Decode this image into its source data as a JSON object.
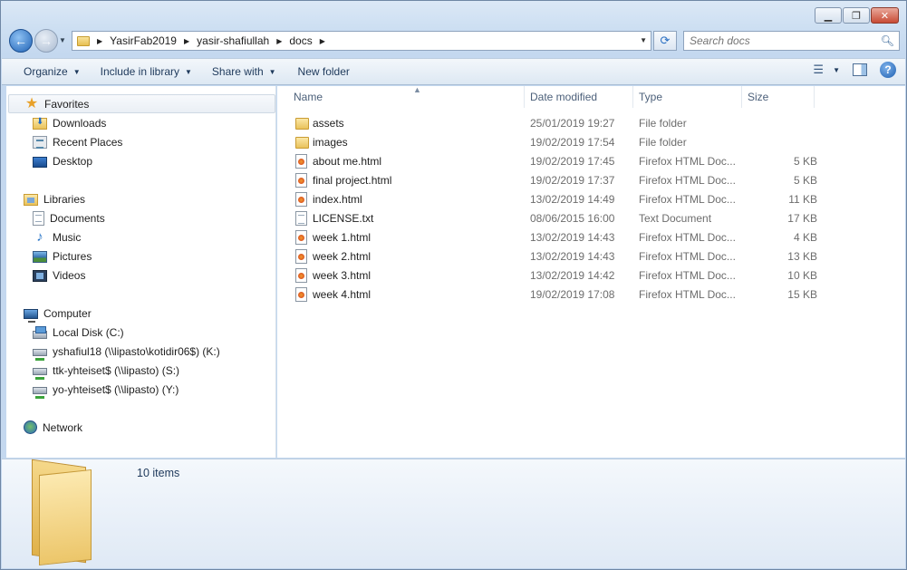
{
  "window": {
    "caption": {
      "minimize": "▁",
      "maximize": "❐",
      "close": "✕"
    }
  },
  "address_bar": {
    "breadcrumbs": [
      "YasirFab2019",
      "yasir-shafiullah",
      "docs"
    ]
  },
  "search": {
    "placeholder": "Search docs"
  },
  "toolbar": {
    "organize": "Organize",
    "include_in_library": "Include in library",
    "share_with": "Share with",
    "new_folder": "New folder"
  },
  "navpane": {
    "favorites": "Favorites",
    "downloads": "Downloads",
    "recent_places": "Recent Places",
    "desktop": "Desktop",
    "libraries": "Libraries",
    "documents": "Documents",
    "music": "Music",
    "pictures": "Pictures",
    "videos": "Videos",
    "computer": "Computer",
    "local_disk": "Local Disk (C:)",
    "drive_k": "yshafiul18 (\\\\lipasto\\kotidir06$) (K:)",
    "drive_s": "ttk-yhteiset$ (\\\\lipasto) (S:)",
    "drive_y": "yo-yhteiset$ (\\\\lipasto) (Y:)",
    "network": "Network"
  },
  "columns": {
    "name": "Name",
    "date_modified": "Date modified",
    "type": "Type",
    "size": "Size"
  },
  "files": [
    {
      "name": "assets",
      "date": "25/01/2019 19:27",
      "type": "File folder",
      "size": "",
      "icon": "folder-icon"
    },
    {
      "name": "images",
      "date": "19/02/2019 17:54",
      "type": "File folder",
      "size": "",
      "icon": "folder-icon"
    },
    {
      "name": "about me.html",
      "date": "19/02/2019 17:45",
      "type": "Firefox HTML Doc...",
      "size": "5 KB",
      "icon": "html-file-icon"
    },
    {
      "name": "final project.html",
      "date": "19/02/2019 17:37",
      "type": "Firefox HTML Doc...",
      "size": "5 KB",
      "icon": "html-file-icon"
    },
    {
      "name": "index.html",
      "date": "13/02/2019 14:49",
      "type": "Firefox HTML Doc...",
      "size": "11 KB",
      "icon": "html-file-icon"
    },
    {
      "name": "LICENSE.txt",
      "date": "08/06/2015 16:00",
      "type": "Text Document",
      "size": "17 KB",
      "icon": "text-file-icon"
    },
    {
      "name": "week 1.html",
      "date": "13/02/2019 14:43",
      "type": "Firefox HTML Doc...",
      "size": "4 KB",
      "icon": "html-file-icon"
    },
    {
      "name": "week 2.html",
      "date": "13/02/2019 14:43",
      "type": "Firefox HTML Doc...",
      "size": "13 KB",
      "icon": "html-file-icon"
    },
    {
      "name": "week 3.html",
      "date": "13/02/2019 14:42",
      "type": "Firefox HTML Doc...",
      "size": "10 KB",
      "icon": "html-file-icon"
    },
    {
      "name": "week 4.html",
      "date": "19/02/2019 17:08",
      "type": "Firefox HTML Doc...",
      "size": "15 KB",
      "icon": "html-file-icon"
    }
  ],
  "details": {
    "item_count": "10 items"
  }
}
